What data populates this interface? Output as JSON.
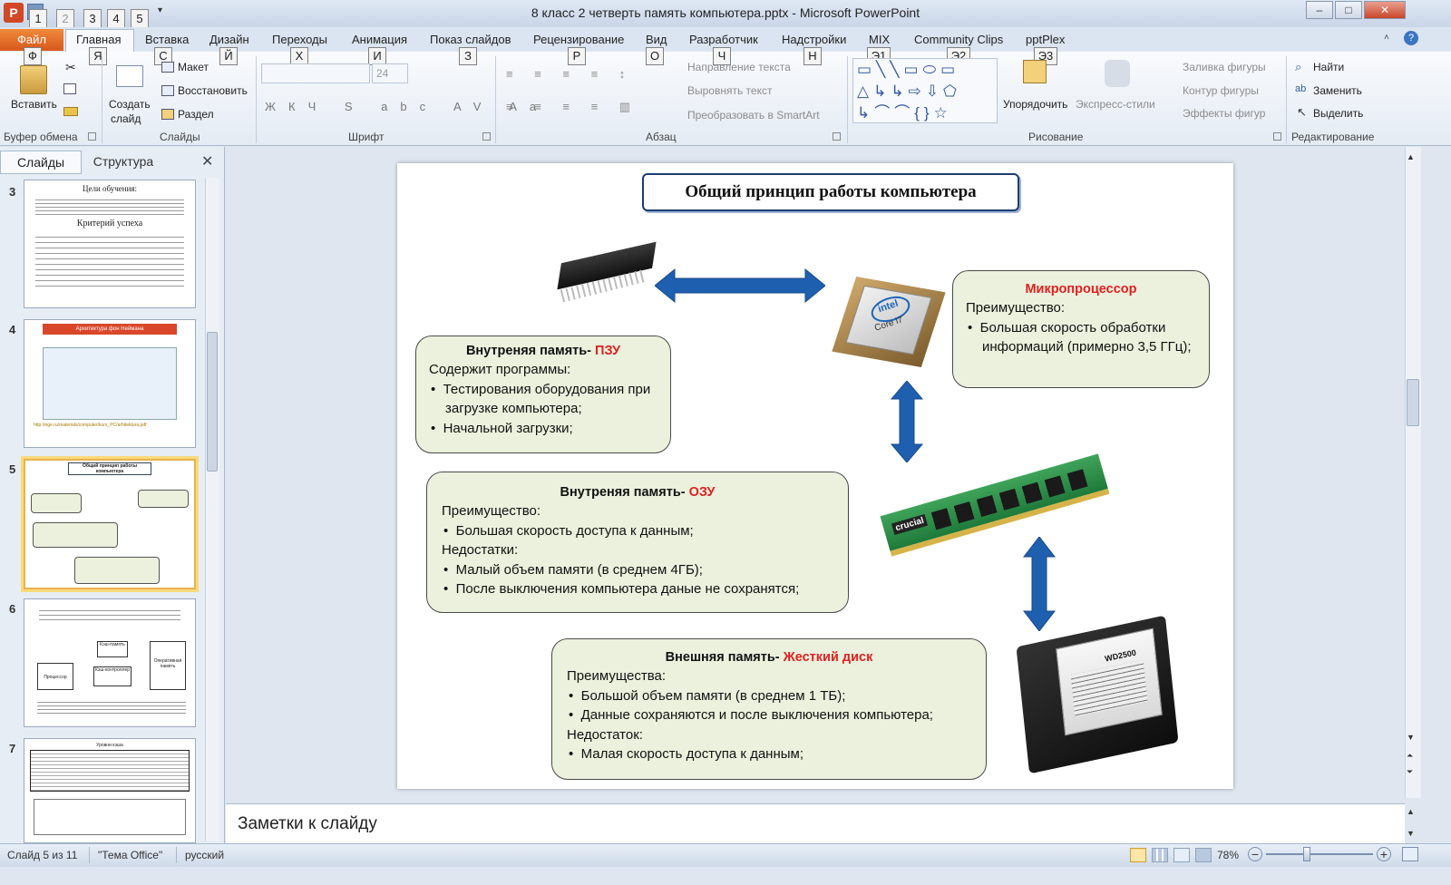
{
  "window": {
    "title": "8 класс 2 четверть  память компьютера.pptx  -  Microsoft PowerPoint",
    "minimize": "–",
    "maximize": "□",
    "close": "✕"
  },
  "qat_keytips": [
    "1",
    "2",
    "3",
    "4",
    "5"
  ],
  "ribbon_tabs": {
    "file": "Файл",
    "items": [
      "Главная",
      "Вставка",
      "Дизайн",
      "Переходы",
      "Анимация",
      "Показ слайдов",
      "Рецензирование",
      "Вид",
      "Разработчик",
      "Надстройки",
      "MIX",
      "Community Clips",
      "pptPlex"
    ]
  },
  "keytips": {
    "file": "Ф",
    "home": "Я",
    "insert": "С",
    "design": "Й",
    "transitions": "Х",
    "animation": "И",
    "slideshow": "З",
    "review": "Р",
    "view": "О",
    "developer": "Ч",
    "addins": "Н",
    "mix": "Э1",
    "clips": "Э2",
    "pptplex": "Э3"
  },
  "ribbon": {
    "clipboard": {
      "label": "Буфер обмена",
      "paste": "Вставить"
    },
    "slides": {
      "label": "Слайды",
      "new_slide_1": "Создать",
      "new_slide_2": "слайд",
      "layout": "Макет",
      "reset": "Восстановить",
      "section": "Раздел"
    },
    "font": {
      "label": "Шрифт",
      "font_name": "",
      "font_size": "24"
    },
    "paragraph": {
      "label": "Абзац",
      "text_direction": "Направление текста",
      "align_text": "Выровнять текст",
      "smartart": "Преобразовать в SmartArt"
    },
    "drawing": {
      "label": "Рисование",
      "arrange": "Упорядочить",
      "quick_styles": "Экспресс-стили",
      "fill": "Заливка фигуры",
      "outline": "Контур фигуры",
      "effects": "Эффекты фигур"
    },
    "editing": {
      "label": "Редактирование",
      "find": "Найти",
      "replace": "Заменить",
      "select": "Выделить"
    }
  },
  "left_pane": {
    "tab_slides": "Слайды",
    "tab_outline": "Структура",
    "thumbs": [
      {
        "num": "3",
        "title": "Цели обучения:",
        "subtitle": "Критерий успеха"
      },
      {
        "num": "4",
        "title": "Архитектура фон Неймана",
        "link": "http://ege.ru/materials/computer/kurs_PC/arhitektura.pdf"
      },
      {
        "num": "5",
        "title": "Общий принцип работы компьютера"
      },
      {
        "num": "6",
        "labels": [
          "Процессор",
          "Кэш-память",
          "Кэш-контроллер",
          "Оперативная память"
        ]
      },
      {
        "num": "7",
        "title": "Уровни кэша"
      }
    ]
  },
  "slide": {
    "title": "Общий принцип работы компьютера",
    "rom_box": {
      "title_prefix": "Внутреняя память- ",
      "title_accent": "ПЗУ",
      "line1": "Содержит программы:",
      "bullets": [
        "Тестирования оборудования при загрузке компьютера;",
        "Начальной загрузки;"
      ]
    },
    "cpu_box": {
      "title": "Микропроцессор",
      "line1": "Преимущество:",
      "bullets": [
        "Большая скорость обработки информаций (примерно  3,5 ГГц);"
      ]
    },
    "ram_box": {
      "title_prefix": "Внутреняя память- ",
      "title_accent": "ОЗУ",
      "adv": "Преимущество:",
      "adv_bullets": [
        "Большая скорость доступа к данным;"
      ],
      "dis": "Недостатки:",
      "dis_bullets": [
        "Малый объем памяти (в среднем 4ГБ);",
        "После выключения  компьютера  даные не сохранятся;"
      ]
    },
    "hdd_box": {
      "title_prefix": "Внешняя память- ",
      "title_accent": "Жесткий диск",
      "adv": "Преимущества:",
      "adv_bullets": [
        "Большой объем памяти (в среднем 1 ТБ);",
        "Данные сохраняются и после выключения  компьютера;"
      ],
      "dis": "Недостаток:",
      "dis_bullets": [
        "Малая скорость доступа к данным;"
      ]
    },
    "chip_labels": {
      "cpu_brand": "intel",
      "cpu_model": "Core i7",
      "ram_brand": "crucial",
      "hdd_model": "WD2500"
    }
  },
  "notes": {
    "placeholder": "Заметки к слайду"
  },
  "status": {
    "slide_info": "Слайд 5 из 11",
    "theme": "\"Тема Office\"",
    "language": "русский",
    "zoom": "78%"
  },
  "colors": {
    "accent_red": "#e02020",
    "box_fill": "#ebf1dd",
    "arrow_blue": "#1f5fb0",
    "file_tab": "#d8581c"
  }
}
